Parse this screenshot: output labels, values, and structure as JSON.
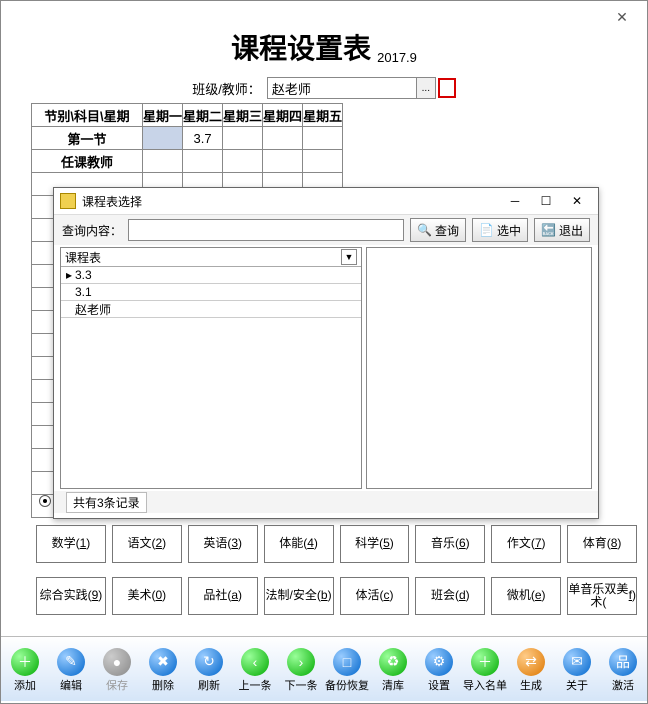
{
  "main": {
    "title": "课程设置表",
    "subtitle": "2017.9",
    "teacher_label": "班级/教师：",
    "teacher_value": "赵老师",
    "browse_label": "...",
    "table": {
      "headers": [
        "节别\\科目\\星期",
        "星期一",
        "星期二",
        "星期三",
        "星期四",
        "星期五"
      ],
      "rows": [
        {
          "label": "第一节",
          "cells": [
            "",
            "3.7",
            "",
            "",
            ""
          ]
        },
        {
          "label": "任课教师",
          "cells": [
            "",
            "",
            "",
            "",
            ""
          ]
        }
      ]
    }
  },
  "subjects_row1": [
    {
      "t": "数学",
      "k": "1"
    },
    {
      "t": "语文",
      "k": "2"
    },
    {
      "t": "英语",
      "k": "3"
    },
    {
      "t": "体能",
      "k": "4"
    },
    {
      "t": "科学",
      "k": "5"
    },
    {
      "t": "音乐",
      "k": "6"
    },
    {
      "t": "作文",
      "k": "7"
    },
    {
      "t": "体育",
      "k": "8"
    }
  ],
  "subjects_row2": [
    {
      "t": "综合实践",
      "k": "9"
    },
    {
      "t": "美术",
      "k": "0"
    },
    {
      "t": "品社",
      "k": "a"
    },
    {
      "t": "法制/安全",
      "k": "b"
    },
    {
      "t": "体活",
      "k": "c"
    },
    {
      "t": "班会",
      "k": "d"
    },
    {
      "t": "微机",
      "k": "e"
    },
    {
      "t": "单音乐双美术",
      "k": "f"
    }
  ],
  "popup": {
    "title": "课程表选择",
    "search_label": "查询内容：",
    "search_value": "",
    "btn_query": "查询",
    "btn_select": "选中",
    "btn_exit": "退出",
    "list_header": "课程表",
    "rows": [
      "3.3",
      "3.1",
      "赵老师"
    ],
    "status": "共有3条记录"
  },
  "bottom": [
    {
      "label": "添加",
      "ico": "＋",
      "cls": "ico-green"
    },
    {
      "label": "编辑",
      "ico": "✎",
      "cls": "ico-blue"
    },
    {
      "label": "保存",
      "ico": "●",
      "cls": "ico-gray",
      "dis": true
    },
    {
      "label": "删除",
      "ico": "✖",
      "cls": "ico-blue"
    },
    {
      "label": "刷新",
      "ico": "↻",
      "cls": "ico-blue"
    },
    {
      "label": "上一条",
      "ico": "‹",
      "cls": "ico-green"
    },
    {
      "label": "下一条",
      "ico": "›",
      "cls": "ico-green"
    },
    {
      "label": "备份恢复",
      "ico": "□",
      "cls": "ico-blue"
    },
    {
      "label": "清库",
      "ico": "♻",
      "cls": "ico-green"
    },
    {
      "label": "设置",
      "ico": "⚙",
      "cls": "ico-blue"
    },
    {
      "label": "导入名单",
      "ico": "＋",
      "cls": "ico-green"
    },
    {
      "label": "生成",
      "ico": "⇄",
      "cls": "ico-orange"
    },
    {
      "label": "关于",
      "ico": "✉",
      "cls": "ico-blue"
    },
    {
      "label": "激活",
      "ico": "品",
      "cls": "ico-blue"
    }
  ]
}
